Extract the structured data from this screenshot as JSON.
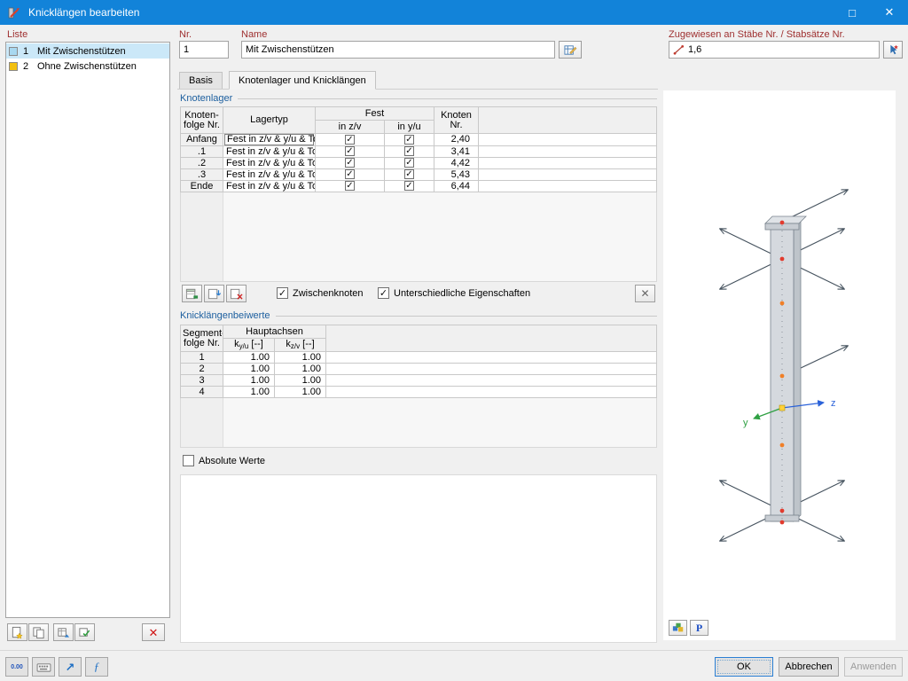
{
  "colors": {
    "titlebar": "#1283d9",
    "label": "#9e2f2f",
    "section": "#1b5e9e",
    "selection": "#cbe8f8",
    "swatch1": "#a8d8f0",
    "swatch2": "#f2c011"
  },
  "glyphs": {
    "check": "✓",
    "close": "✕",
    "maximize": "□",
    "clear": "✕",
    "delete": "✕",
    "import_arrow": "↗",
    "formula": "ƒ",
    "print": "P"
  },
  "window": {
    "title": "Knicklängen bearbeiten"
  },
  "liste": {
    "label": "Liste",
    "items": [
      {
        "nr": "1",
        "name": "Mit Zwischenstützen"
      },
      {
        "nr": "2",
        "name": "Ohne Zwischenstützen"
      }
    ]
  },
  "fields": {
    "nr_label": "Nr.",
    "nr_value": "1",
    "name_label": "Name",
    "name_value": "Mit Zwischenstützen",
    "assigned_label": "Zugewiesen an Stäbe Nr. / Stabsätze Nr.",
    "assigned_value": "1,6"
  },
  "tabs": {
    "basis": "Basis",
    "knotenlager": "Knotenlager und Knicklängen"
  },
  "knotenlager": {
    "title": "Knotenlager",
    "headers": {
      "folge1": "Knoten-",
      "folge2": "folge Nr.",
      "lagertyp": "Lagertyp",
      "fest": "Fest",
      "in_zv": "in z/v",
      "in_yu": "in y/u",
      "knoten1": "Knoten",
      "knoten2": "Nr."
    },
    "rows": [
      {
        "folge": "Anfang",
        "lagertyp": "Fest in z/v & y/u & To...",
        "zv": true,
        "yu": true,
        "knoten": "2,40"
      },
      {
        "folge": ".1",
        "lagertyp": "Fest in z/v & y/u & To...",
        "zv": true,
        "yu": true,
        "knoten": "3,41"
      },
      {
        "folge": ".2",
        "lagertyp": "Fest in z/v & y/u & To...",
        "zv": true,
        "yu": true,
        "knoten": "4,42"
      },
      {
        "folge": ".3",
        "lagertyp": "Fest in z/v & y/u & To...",
        "zv": true,
        "yu": true,
        "knoten": "5,43"
      },
      {
        "folge": "Ende",
        "lagertyp": "Fest in z/v & y/u & To...",
        "zv": true,
        "yu": true,
        "knoten": "6,44"
      }
    ],
    "zwischenknoten_label": "Zwischenknoten",
    "zwischenknoten_checked": true,
    "eigenschaften_label": "Unterschiedliche Eigenschaften",
    "eigenschaften_checked": true
  },
  "beiwerte": {
    "title": "Knicklängenbeiwerte",
    "headers": {
      "folge1": "Segment-",
      "folge2": "folge Nr.",
      "hauptachsen": "Hauptachsen",
      "ky_base": "k",
      "ky_sub": "y/u",
      "ky_unit": " [--]",
      "kz_base": "k",
      "kz_sub": "z/v",
      "kz_unit": " [--]"
    },
    "rows": [
      {
        "nr": "1",
        "ky": "1.00",
        "kz": "1.00"
      },
      {
        "nr": "2",
        "ky": "1.00",
        "kz": "1.00"
      },
      {
        "nr": "3",
        "ky": "1.00",
        "kz": "1.00"
      },
      {
        "nr": "4",
        "ky": "1.00",
        "kz": "1.00"
      }
    ],
    "absolute_label": "Absolute Werte",
    "absolute_checked": false
  },
  "viewport": {
    "axis_y": "y",
    "axis_z": "z"
  },
  "footer": {
    "units": "0.00",
    "ok": "OK",
    "cancel": "Abbrechen",
    "apply": "Anwenden"
  }
}
